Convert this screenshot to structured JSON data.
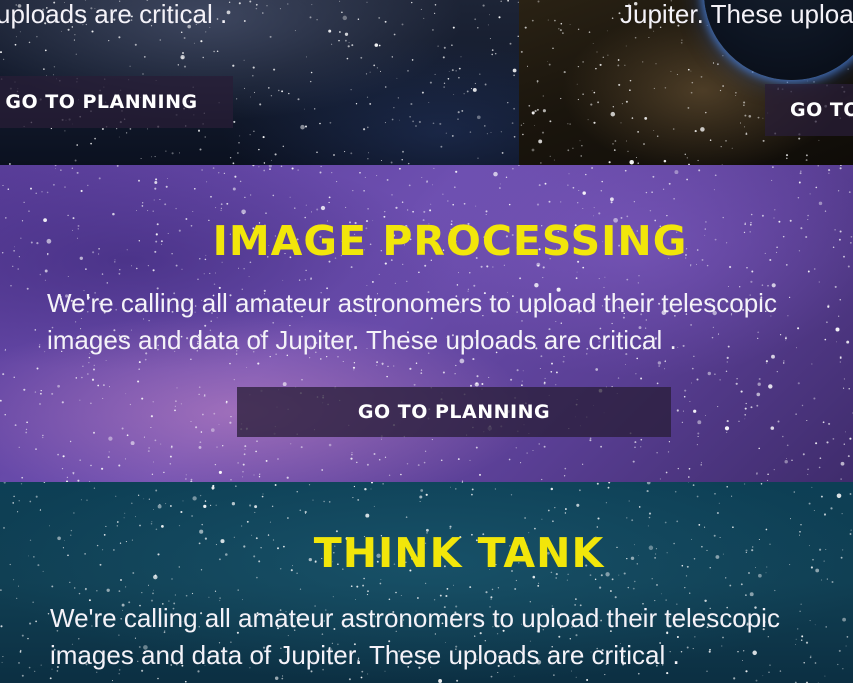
{
  "sections": {
    "top_left": {
      "body_tail": "uploads are critical .",
      "button_label": "GO TO PLANNING"
    },
    "top_right": {
      "body_tail": "Jupiter. These uploads are critical .",
      "button_label": "GO TO PLANNING"
    },
    "image_processing": {
      "title": "IMAGE PROCESSING",
      "body_line1": "We're calling all amateur astronomers to upload their telescopic",
      "body_line2": "images and data of Jupiter. These uploads are critical .",
      "button_label": "GO TO PLANNING"
    },
    "think_tank": {
      "title": "THINK TANK",
      "body_line1": "We're calling all amateur astronomers to upload their telescopic",
      "body_line2": "images and data of Jupiter. These uploads are critical ."
    }
  },
  "colors": {
    "title_yellow": "#f2e60a",
    "body_white": "#f4f2f8",
    "button_bg": "#281e37"
  }
}
